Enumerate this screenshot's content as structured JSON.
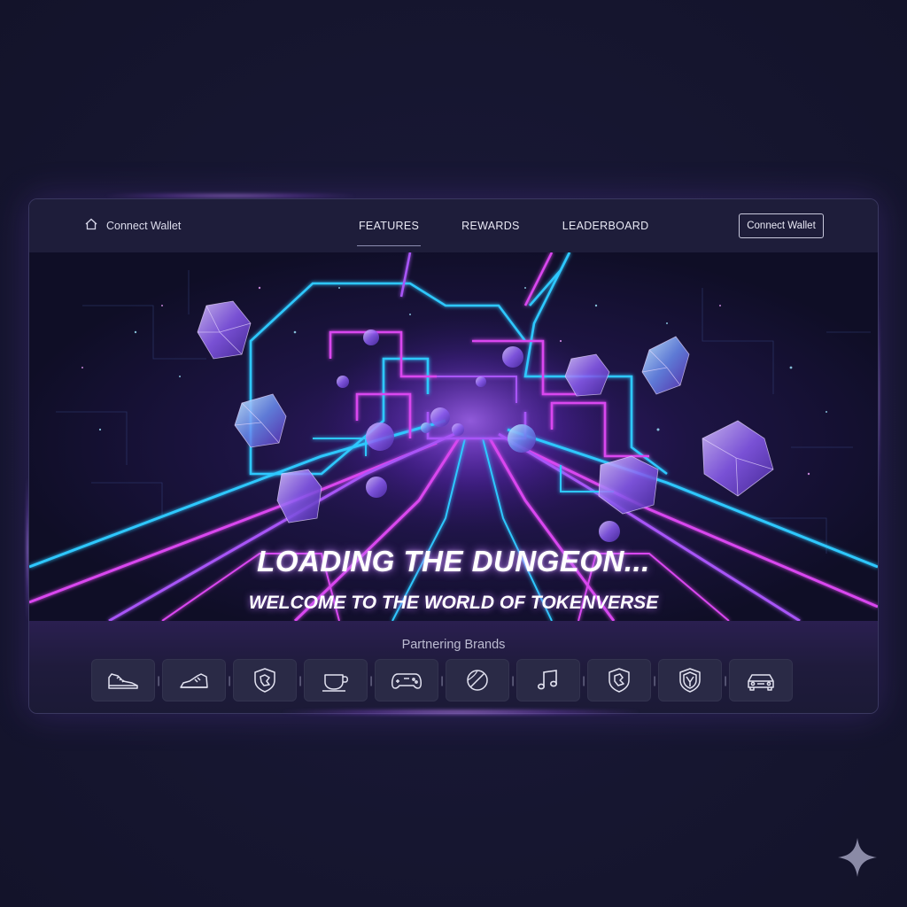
{
  "nav": {
    "home_label": "Connect Wallet",
    "tabs": [
      {
        "label": "FEATURES",
        "active": true
      },
      {
        "label": "REWARDS",
        "active": false
      },
      {
        "label": "LEADERBOARD",
        "active": false
      }
    ],
    "connect_button": "Connect Wallet"
  },
  "hero": {
    "title": "LOADING THE DUNGEON...",
    "subtitle": "WELCOME TO THE WORLD OF TOKENVERSE"
  },
  "brands": {
    "label": "Partnering Brands",
    "items": [
      {
        "icon": "sneaker-icon"
      },
      {
        "icon": "shoe-icon"
      },
      {
        "icon": "shield-crest-icon"
      },
      {
        "icon": "coffee-cup-icon"
      },
      {
        "icon": "gamepad-icon"
      },
      {
        "icon": "ball-icon"
      },
      {
        "icon": "music-note-icon"
      },
      {
        "icon": "shield-crest-icon"
      },
      {
        "icon": "shield-emblem-icon"
      },
      {
        "icon": "car-icon"
      }
    ]
  },
  "colors": {
    "background": "#161630",
    "neon_cyan": "#2ec8ff",
    "neon_magenta": "#d946ef",
    "neon_purple": "#a855f7"
  }
}
